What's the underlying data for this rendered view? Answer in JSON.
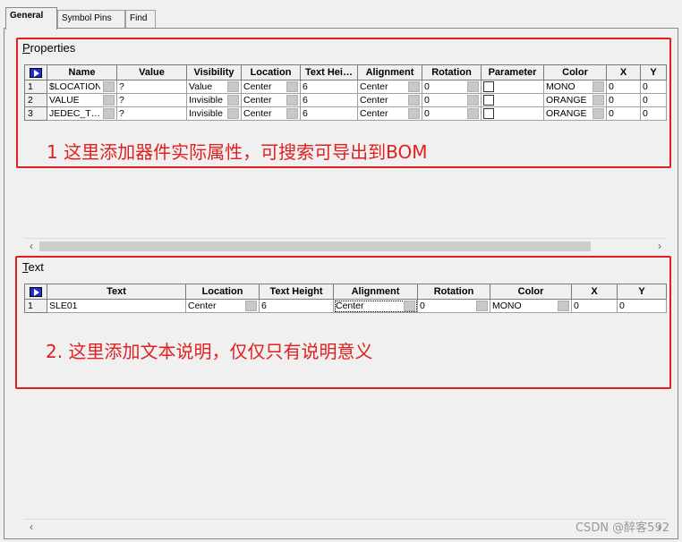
{
  "tabs": [
    {
      "label": "General",
      "active": true
    },
    {
      "label": "Symbol Pins",
      "active": false
    },
    {
      "label": "Find",
      "active": false
    }
  ],
  "properties": {
    "title": "Properties",
    "title_underline_char": "P",
    "title_rest": "roperties",
    "columns": [
      "Name",
      "Value",
      "Visibility",
      "Location",
      "Text Hei…",
      "Alignment",
      "Rotation",
      "Parameter",
      "Color",
      "X",
      "Y"
    ],
    "rows": [
      {
        "num": "1",
        "name": "$LOCATION",
        "value": "?",
        "visibility": "Value",
        "location": "Center",
        "text_height": "6",
        "alignment": "Center",
        "rotation": "0",
        "parameter": false,
        "color": "MONO",
        "x": "0",
        "y": "0"
      },
      {
        "num": "2",
        "name": "VALUE",
        "value": "?",
        "visibility": "Invisible",
        "location": "Center",
        "text_height": "6",
        "alignment": "Center",
        "rotation": "0",
        "parameter": false,
        "color": "ORANGE",
        "x": "0",
        "y": "0"
      },
      {
        "num": "3",
        "name": "JEDEC_T…",
        "value": "?",
        "visibility": "Invisible",
        "location": "Center",
        "text_height": "6",
        "alignment": "Center",
        "rotation": "0",
        "parameter": false,
        "color": "ORANGE",
        "x": "0",
        "y": "0"
      }
    ],
    "annotation": "1 这里添加器件实际属性，可搜索可导出到BOM"
  },
  "text_section": {
    "title": "Text",
    "title_underline_char": "T",
    "title_rest": "ext",
    "columns": [
      "Text",
      "Location",
      "Text Height",
      "Alignment",
      "Rotation",
      "Color",
      "X",
      "Y"
    ],
    "rows": [
      {
        "num": "1",
        "text": "SLE01",
        "location": "Center",
        "text_height": "6",
        "alignment": "Center",
        "rotation": "0",
        "color": "MONO",
        "x": "0",
        "y": "0"
      }
    ],
    "annotation": "2. 这里添加文本说明，仅仅只有说明意义"
  },
  "scroll_arrows": {
    "left": "‹",
    "right": "›"
  },
  "watermark": "CSDN @醉客592",
  "colors": {
    "annotation": "#e02020",
    "corner_icon": "#1e2fd0"
  }
}
